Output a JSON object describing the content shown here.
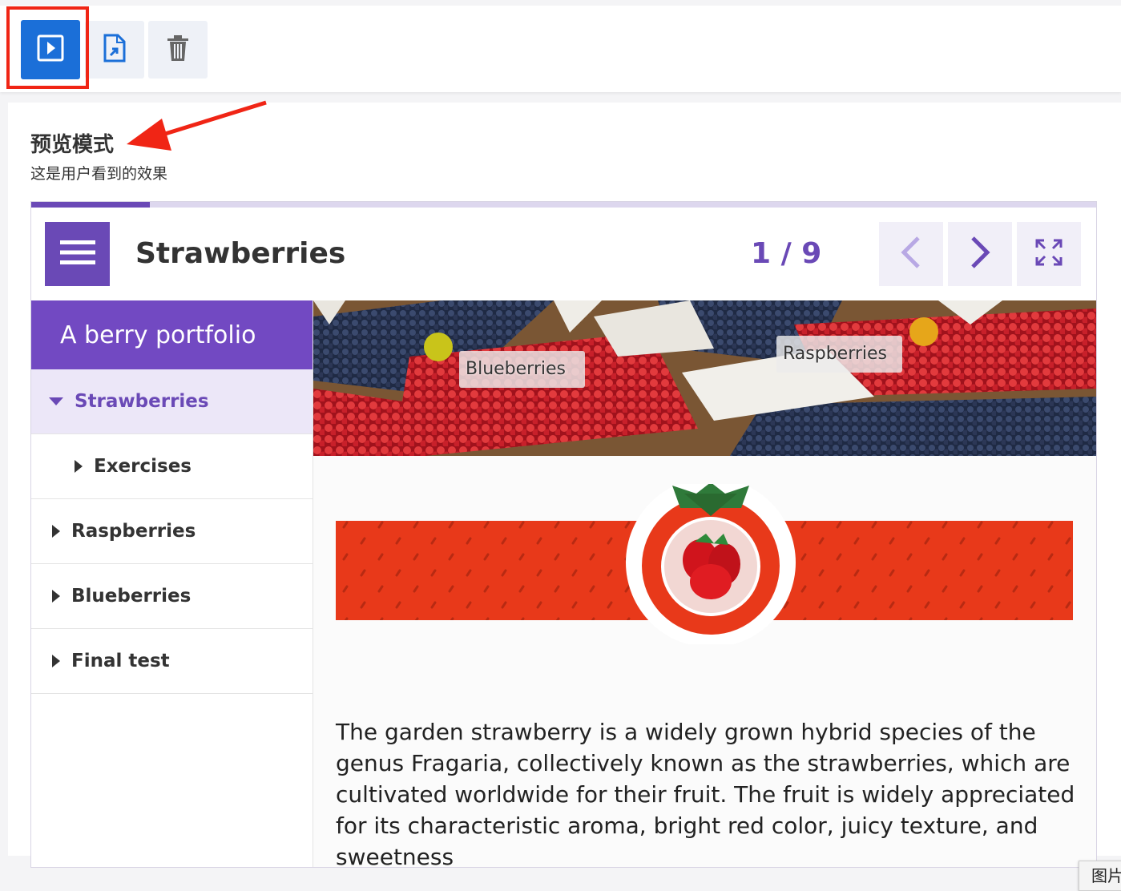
{
  "toolbar": {
    "buttons": [
      {
        "name": "preview",
        "icon": "play-preview-icon",
        "color": "#1b6fd8"
      },
      {
        "name": "export",
        "icon": "export-document-icon"
      },
      {
        "name": "delete",
        "icon": "trash-icon"
      }
    ]
  },
  "preview": {
    "title": "预览模式",
    "subtitle": "这是用户看到的效果"
  },
  "book": {
    "chapter_title": "Strawberries",
    "page_counter": "1 / 9",
    "progress_fraction": 0.111,
    "accent_color": "#6a49b6",
    "sidebar": {
      "heading": "A berry portfolio",
      "items": [
        {
          "label": "Strawberries",
          "expanded": true,
          "active": true
        },
        {
          "label": "Exercises",
          "sub": true
        },
        {
          "label": "Raspberries"
        },
        {
          "label": "Blueberries"
        },
        {
          "label": "Final test"
        }
      ]
    },
    "hotspots": [
      {
        "label": "Blueberries",
        "dot_color": "#c9c41a"
      },
      {
        "label": "Raspberries",
        "dot_color": "#e6a61a"
      }
    ],
    "image_tooltip": "图片",
    "body_text": "The garden strawberry is a widely grown hybrid species of the genus Fragaria, collectively known as the strawberries, which are cultivated worldwide for their fruit. The fruit is widely appreciated for its characteristic aroma, bright red color, juicy texture, and sweetness"
  }
}
